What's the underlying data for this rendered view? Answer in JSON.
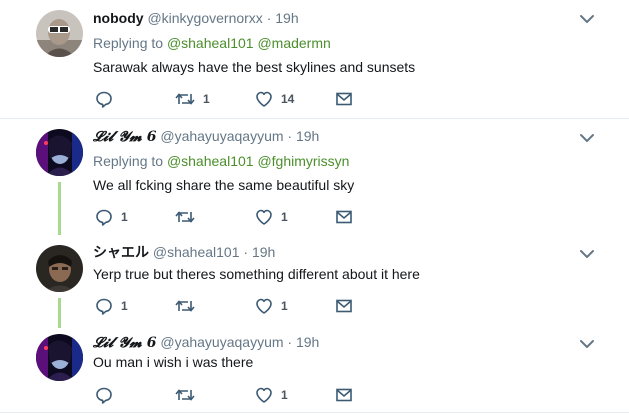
{
  "tweets": [
    {
      "name": "nobody",
      "handle": "@kinkygovernorxx",
      "separator": "·",
      "time": "19h",
      "replying_prefix": "Replying to",
      "mentions": [
        "@shaheal101",
        "@madermn"
      ],
      "text": "Sarawak always have the best skylines and sunsets",
      "reply_count": "",
      "retweet_count": "1",
      "like_count": "14"
    },
    {
      "name": "𝓛𝓲𝓵 𝓨𝓶 6",
      "handle": "@yahayuyaqayyum",
      "separator": "·",
      "time": "19h",
      "replying_prefix": "Replying to",
      "mentions": [
        "@shaheal101",
        "@fghimyrissyn"
      ],
      "text": "We all fcking share the same beautiful sky",
      "reply_count": "1",
      "retweet_count": "",
      "like_count": "1"
    },
    {
      "name": "シャエル",
      "handle": "@shaheal101",
      "separator": "·",
      "time": "19h",
      "text": "Yerp true but theres something different about it here",
      "reply_count": "1",
      "retweet_count": "",
      "like_count": "1"
    },
    {
      "name": "𝓛𝓲𝓵 𝓨𝓶 6",
      "handle": "@yahayuyaqayyum",
      "separator": "·",
      "time": "19h",
      "text": "Ou man i wish i was there",
      "reply_count": "",
      "retweet_count": "",
      "like_count": "1"
    }
  ],
  "colors": {
    "mention_link": "#4b8f2c",
    "thread_line": "#a7d98f",
    "secondary_text": "#657786",
    "icon": "#3c5a73"
  },
  "icons": [
    "reply-icon",
    "retweet-icon",
    "heart-icon",
    "message-icon",
    "chevron-down-icon"
  ]
}
